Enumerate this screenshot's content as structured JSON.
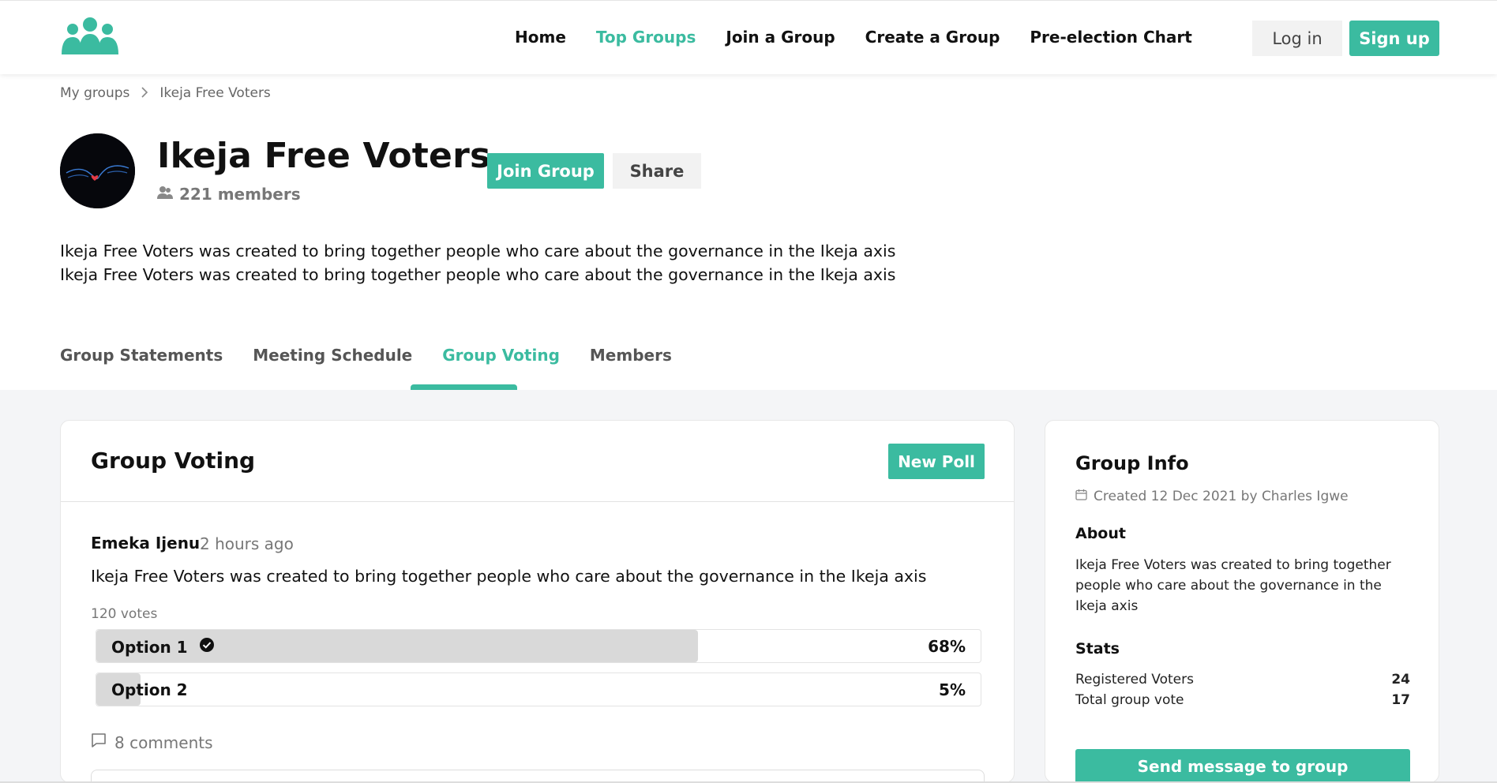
{
  "header": {
    "nav": [
      "Home",
      "Top Groups",
      "Join a Group",
      "Create a Group",
      "Pre-election Chart"
    ],
    "active_nav": "Top Groups",
    "login_label": "Log in",
    "signup_label": "Sign up"
  },
  "breadcrumb": {
    "parent": "My groups",
    "current": "Ikeja Free Voters"
  },
  "group": {
    "name": "Ikeja Free Voters",
    "members": "221 members",
    "join_label": "Join Group",
    "share_label": "Share",
    "description_line1": "Ikeja Free Voters was created to bring together people who care about the governance in the Ikeja axis",
    "description_line2": "Ikeja Free Voters was created to bring together people who care about the governance in the Ikeja axis"
  },
  "tabs": {
    "items": [
      "Group Statements",
      "Meeting Schedule",
      "Group Voting",
      "Members"
    ],
    "active": "Group Voting"
  },
  "voting": {
    "title": "Group Voting",
    "new_poll_label": "New Poll",
    "post": {
      "author": "Emeka Ijenu",
      "time": "2 hours ago",
      "text": "Ikeja Free Voters was created to bring together people who care about the governance in the Ikeja axis",
      "votes": "120 votes",
      "options": [
        {
          "label": "Option 1",
          "percent": "68%",
          "fill": 0.68,
          "selected": true
        },
        {
          "label": "Option 2",
          "percent": "5%",
          "fill": 0.05,
          "selected": false
        }
      ],
      "comments": "8 comments"
    }
  },
  "info": {
    "title": "Group Info",
    "created": "Created 12 Dec 2021 by Charles Igwe",
    "about_heading": "About",
    "about_text": "Ikeja Free Voters was created to bring together people who care about the governance in the Ikeja axis",
    "stats_heading": "Stats",
    "stats": [
      {
        "label": "Registered Voters",
        "value": "24"
      },
      {
        "label": "Total group vote",
        "value": "17"
      }
    ],
    "send_label": "Send message to group"
  },
  "colors": {
    "accent": "#3bbba0"
  }
}
